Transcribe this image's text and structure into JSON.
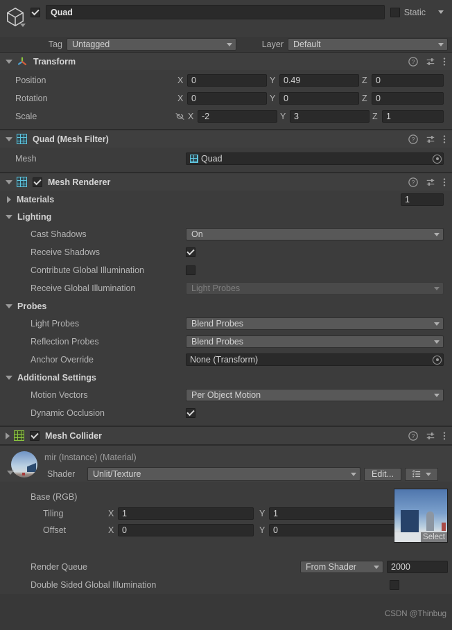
{
  "gameobject": {
    "icon": "cube-icon",
    "enabled": true,
    "name": "Quad",
    "static_label": "Static",
    "static_checked": false,
    "tag_label": "Tag",
    "tag_value": "Untagged",
    "layer_label": "Layer",
    "layer_value": "Default"
  },
  "transform": {
    "title": "Transform",
    "icon": "transform-gizmo-icon",
    "expanded": true,
    "rows": [
      {
        "label": "Position",
        "x": "0",
        "y": "0.49",
        "z": "0"
      },
      {
        "label": "Rotation",
        "x": "0",
        "y": "0",
        "z": "0"
      },
      {
        "label": "Scale",
        "x": "-2",
        "y": "3",
        "z": "1"
      }
    ],
    "axis_x": "X",
    "axis_y": "Y",
    "axis_z": "Z",
    "scale_constrain_icon": "link-off-icon"
  },
  "mesh_filter": {
    "title": "Quad (Mesh Filter)",
    "icon": "mesh-filter-grid-icon",
    "expanded": true,
    "mesh_label": "Mesh",
    "mesh_value": "Quad"
  },
  "mesh_renderer": {
    "title": "Mesh Renderer",
    "icon": "mesh-renderer-grid-icon",
    "expanded": true,
    "enabled": true,
    "materials": {
      "label": "Materials",
      "count": "1",
      "expanded": false
    },
    "lighting": {
      "label": "Lighting",
      "cast_shadows": {
        "label": "Cast Shadows",
        "value": "On"
      },
      "receive_shadows": {
        "label": "Receive Shadows",
        "checked": true
      },
      "contribute_gi": {
        "label": "Contribute Global Illumination",
        "checked": false
      },
      "receive_gi": {
        "label": "Receive Global Illumination",
        "value": "Light Probes",
        "disabled": true
      }
    },
    "probes": {
      "label": "Probes",
      "light_probes": {
        "label": "Light Probes",
        "value": "Blend Probes"
      },
      "reflection_probes": {
        "label": "Reflection Probes",
        "value": "Blend Probes"
      },
      "anchor_override": {
        "label": "Anchor Override",
        "value": "None (Transform)"
      }
    },
    "additional": {
      "label": "Additional Settings",
      "motion_vectors": {
        "label": "Motion Vectors",
        "value": "Per Object Motion"
      },
      "dynamic_occlusion": {
        "label": "Dynamic Occlusion",
        "checked": true
      }
    }
  },
  "mesh_collider": {
    "title": "Mesh Collider",
    "icon": "mesh-collider-grid-icon",
    "expanded": false,
    "enabled": true
  },
  "material": {
    "title": "mir (Instance) (Material)",
    "preview_icon": "material-sphere-preview",
    "shader_label": "Shader",
    "shader_value": "Unlit/Texture",
    "edit_label": "Edit...",
    "preset_icon": "preset-list-icon",
    "base_label": "Base (RGB)",
    "tiling": {
      "label": "Tiling",
      "x": "1",
      "y": "1"
    },
    "offset": {
      "label": "Offset",
      "x": "0",
      "y": "0"
    },
    "axis_x": "X",
    "axis_y": "Y",
    "texture_select_label": "Select",
    "render_queue": {
      "label": "Render Queue",
      "mode": "From Shader",
      "value": "2000"
    },
    "double_sided_gi": {
      "label": "Double Sided Global Illumination",
      "checked": false
    }
  },
  "header_icons": {
    "help": "help-icon",
    "preset": "preset-icon",
    "menu": "kebab-menu-icon"
  },
  "watermark": "CSDN @Thinbug",
  "colors": {
    "background": "#383838",
    "panel": "#3c3c3c",
    "field": "#2a2a2a",
    "dropdown": "#585858",
    "mesh_filter_icon": "#5fc6e0",
    "collider_icon": "#8cc63f"
  }
}
